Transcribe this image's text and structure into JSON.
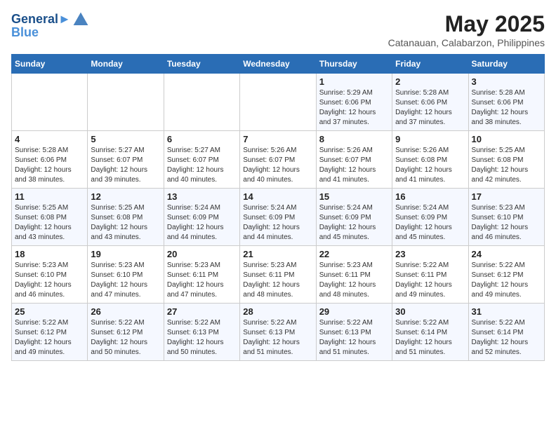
{
  "logo": {
    "line1": "General",
    "line2": "Blue"
  },
  "title": "May 2025",
  "subtitle": "Catanauan, Calabarzon, Philippines",
  "days_of_week": [
    "Sunday",
    "Monday",
    "Tuesday",
    "Wednesday",
    "Thursday",
    "Friday",
    "Saturday"
  ],
  "weeks": [
    [
      {
        "day": "",
        "info": ""
      },
      {
        "day": "",
        "info": ""
      },
      {
        "day": "",
        "info": ""
      },
      {
        "day": "",
        "info": ""
      },
      {
        "day": "1",
        "info": "Sunrise: 5:29 AM\nSunset: 6:06 PM\nDaylight: 12 hours\nand 37 minutes."
      },
      {
        "day": "2",
        "info": "Sunrise: 5:28 AM\nSunset: 6:06 PM\nDaylight: 12 hours\nand 37 minutes."
      },
      {
        "day": "3",
        "info": "Sunrise: 5:28 AM\nSunset: 6:06 PM\nDaylight: 12 hours\nand 38 minutes."
      }
    ],
    [
      {
        "day": "4",
        "info": "Sunrise: 5:28 AM\nSunset: 6:06 PM\nDaylight: 12 hours\nand 38 minutes."
      },
      {
        "day": "5",
        "info": "Sunrise: 5:27 AM\nSunset: 6:07 PM\nDaylight: 12 hours\nand 39 minutes."
      },
      {
        "day": "6",
        "info": "Sunrise: 5:27 AM\nSunset: 6:07 PM\nDaylight: 12 hours\nand 40 minutes."
      },
      {
        "day": "7",
        "info": "Sunrise: 5:26 AM\nSunset: 6:07 PM\nDaylight: 12 hours\nand 40 minutes."
      },
      {
        "day": "8",
        "info": "Sunrise: 5:26 AM\nSunset: 6:07 PM\nDaylight: 12 hours\nand 41 minutes."
      },
      {
        "day": "9",
        "info": "Sunrise: 5:26 AM\nSunset: 6:08 PM\nDaylight: 12 hours\nand 41 minutes."
      },
      {
        "day": "10",
        "info": "Sunrise: 5:25 AM\nSunset: 6:08 PM\nDaylight: 12 hours\nand 42 minutes."
      }
    ],
    [
      {
        "day": "11",
        "info": "Sunrise: 5:25 AM\nSunset: 6:08 PM\nDaylight: 12 hours\nand 43 minutes."
      },
      {
        "day": "12",
        "info": "Sunrise: 5:25 AM\nSunset: 6:08 PM\nDaylight: 12 hours\nand 43 minutes."
      },
      {
        "day": "13",
        "info": "Sunrise: 5:24 AM\nSunset: 6:09 PM\nDaylight: 12 hours\nand 44 minutes."
      },
      {
        "day": "14",
        "info": "Sunrise: 5:24 AM\nSunset: 6:09 PM\nDaylight: 12 hours\nand 44 minutes."
      },
      {
        "day": "15",
        "info": "Sunrise: 5:24 AM\nSunset: 6:09 PM\nDaylight: 12 hours\nand 45 minutes."
      },
      {
        "day": "16",
        "info": "Sunrise: 5:24 AM\nSunset: 6:09 PM\nDaylight: 12 hours\nand 45 minutes."
      },
      {
        "day": "17",
        "info": "Sunrise: 5:23 AM\nSunset: 6:10 PM\nDaylight: 12 hours\nand 46 minutes."
      }
    ],
    [
      {
        "day": "18",
        "info": "Sunrise: 5:23 AM\nSunset: 6:10 PM\nDaylight: 12 hours\nand 46 minutes."
      },
      {
        "day": "19",
        "info": "Sunrise: 5:23 AM\nSunset: 6:10 PM\nDaylight: 12 hours\nand 47 minutes."
      },
      {
        "day": "20",
        "info": "Sunrise: 5:23 AM\nSunset: 6:11 PM\nDaylight: 12 hours\nand 47 minutes."
      },
      {
        "day": "21",
        "info": "Sunrise: 5:23 AM\nSunset: 6:11 PM\nDaylight: 12 hours\nand 48 minutes."
      },
      {
        "day": "22",
        "info": "Sunrise: 5:23 AM\nSunset: 6:11 PM\nDaylight: 12 hours\nand 48 minutes."
      },
      {
        "day": "23",
        "info": "Sunrise: 5:22 AM\nSunset: 6:11 PM\nDaylight: 12 hours\nand 49 minutes."
      },
      {
        "day": "24",
        "info": "Sunrise: 5:22 AM\nSunset: 6:12 PM\nDaylight: 12 hours\nand 49 minutes."
      }
    ],
    [
      {
        "day": "25",
        "info": "Sunrise: 5:22 AM\nSunset: 6:12 PM\nDaylight: 12 hours\nand 49 minutes."
      },
      {
        "day": "26",
        "info": "Sunrise: 5:22 AM\nSunset: 6:12 PM\nDaylight: 12 hours\nand 50 minutes."
      },
      {
        "day": "27",
        "info": "Sunrise: 5:22 AM\nSunset: 6:13 PM\nDaylight: 12 hours\nand 50 minutes."
      },
      {
        "day": "28",
        "info": "Sunrise: 5:22 AM\nSunset: 6:13 PM\nDaylight: 12 hours\nand 51 minutes."
      },
      {
        "day": "29",
        "info": "Sunrise: 5:22 AM\nSunset: 6:13 PM\nDaylight: 12 hours\nand 51 minutes."
      },
      {
        "day": "30",
        "info": "Sunrise: 5:22 AM\nSunset: 6:14 PM\nDaylight: 12 hours\nand 51 minutes."
      },
      {
        "day": "31",
        "info": "Sunrise: 5:22 AM\nSunset: 6:14 PM\nDaylight: 12 hours\nand 52 minutes."
      }
    ]
  ]
}
